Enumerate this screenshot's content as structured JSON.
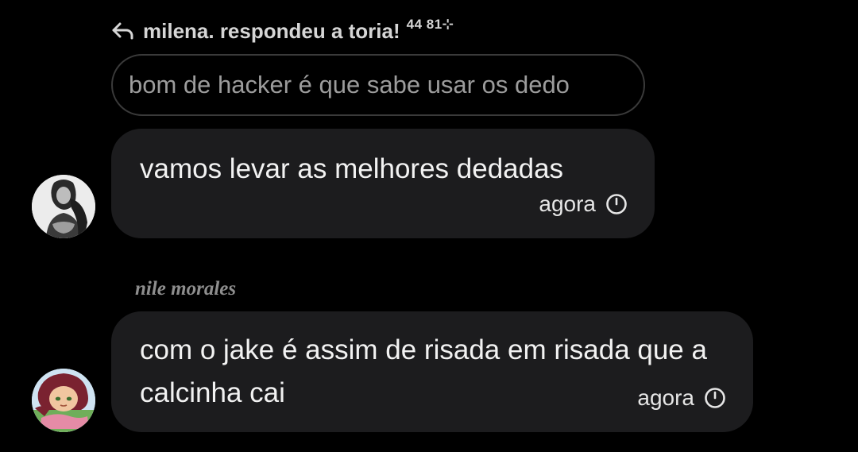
{
  "reply": {
    "icon": "reply-arrow-icon",
    "text": "milena. respondeu a toria!",
    "numbers": "44 81⊹"
  },
  "quote": {
    "text": "bom de hacker é que sabe usar os dedo"
  },
  "messages": [
    {
      "avatar": "user-avatar-photo",
      "text": "vamos levar as melhores dedadas",
      "time": "agora",
      "status_icon": "clock-icon"
    },
    {
      "sender": "nile morales",
      "avatar": "user-avatar-cartoon",
      "text": "com o jake é assim de risada em risada que a calcinha cai",
      "time": "agora",
      "status_icon": "clock-icon"
    }
  ],
  "colors": {
    "background": "#000000",
    "bubble": "#1c1c1e",
    "quote_border": "#3a3a3a",
    "muted_text": "#9c9c9c"
  }
}
